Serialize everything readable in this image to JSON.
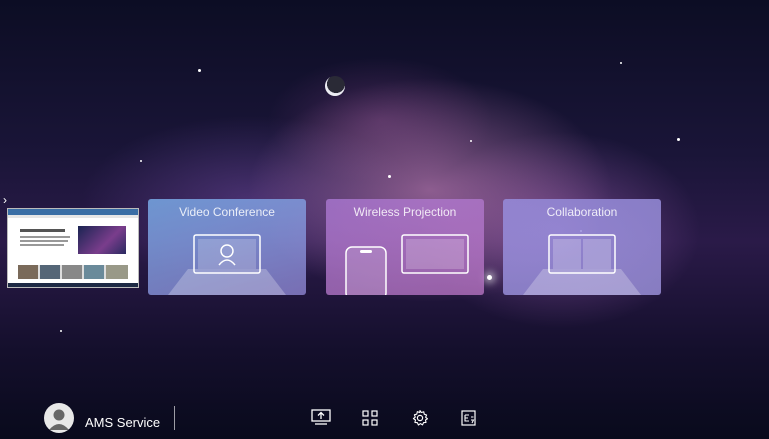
{
  "cards": [
    {
      "id": "video",
      "label": "Video Conference",
      "icon": "video-conference-icon"
    },
    {
      "id": "wireless",
      "label": "Wireless Projection",
      "icon": "wireless-projection-icon"
    },
    {
      "id": "collab",
      "label": "Collaboration",
      "icon": "collaboration-icon"
    }
  ],
  "sidebar": {
    "handle": "›",
    "thumbnail": "browser-window-preview"
  },
  "taskbar": {
    "user_name": "AMS Service",
    "avatar_icon": "user-avatar-icon",
    "icons": [
      "screen-share-icon",
      "apps-grid-icon",
      "settings-gear-icon",
      "input-source-icon"
    ]
  },
  "colors": {
    "text": "#ffffff",
    "card_video": "#7aa9e6",
    "card_wireless": "#b77ccd",
    "card_collab": "#9b8fdc"
  }
}
